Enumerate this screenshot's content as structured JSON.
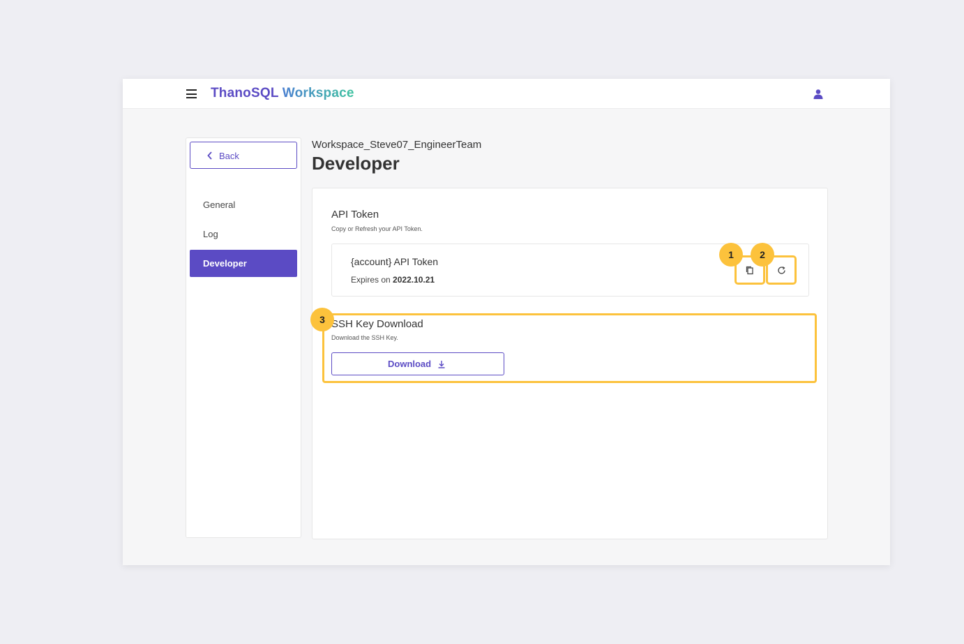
{
  "header": {
    "brand_part1": "ThanoSQL",
    "brand_part2": "Workspace",
    "menu_icon": "hamburger-menu-icon",
    "user_icon": "user-icon"
  },
  "sidebar": {
    "back_label": "Back",
    "items": [
      {
        "label": "General",
        "active": false
      },
      {
        "label": "Log",
        "active": false
      },
      {
        "label": "Developer",
        "active": true
      }
    ]
  },
  "main": {
    "workspace_name": "Workspace_Steve07_EngineerTeam",
    "page_title": "Developer",
    "api_token": {
      "title": "API Token",
      "subtitle": "Copy or Refresh your API Token.",
      "token_name": "{account} API Token",
      "expires_prefix": "Expires on",
      "expires_date": "2022.10.21",
      "copy_icon": "copy-icon",
      "refresh_icon": "refresh-icon"
    },
    "ssh_key": {
      "title": "SSH Key Download",
      "subtitle": "Download the SSH Key.",
      "download_label": "Download",
      "download_icon": "download-icon"
    }
  },
  "annotations": {
    "badge_1": "1",
    "badge_2": "2",
    "badge_3": "3",
    "highlight_color": "#fcc23c"
  },
  "colors": {
    "accent": "#5b4bc4",
    "brand_gradient_start": "#4a7fd0",
    "brand_gradient_end": "#3fc3a0",
    "background": "#eeeef3"
  }
}
